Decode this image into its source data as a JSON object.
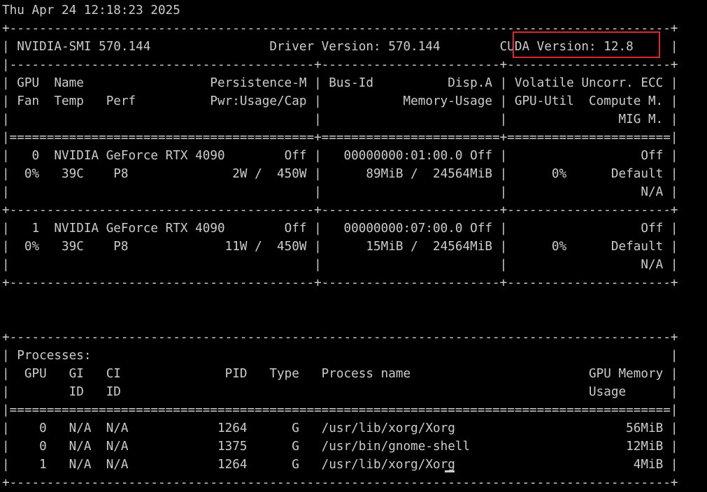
{
  "terminal": {
    "lines": [
      "Thu Apr 24 12:18:23 2025",
      "+-----------------------------------------------------------------------------------------+",
      "| NVIDIA-SMI 570.144                Driver Version: 570.144        CUDA Version: 12.8     |",
      "|-----------------------------------------+------------------------+----------------------+",
      "| GPU  Name                 Persistence-M | Bus-Id          Disp.A | Volatile Uncorr. ECC |",
      "| Fan  Temp   Perf          Pwr:Usage/Cap |           Memory-Usage | GPU-Util  Compute M. |",
      "|                                         |                        |               MIG M. |",
      "|=========================================+========================+======================|",
      "|   0  NVIDIA GeForce RTX 4090        Off |   00000000:01:00.0 Off |                  Off |",
      "|  0%   39C    P8              2W /  450W |      89MiB /  24564MiB |      0%      Default |",
      "|                                         |                        |                  N/A |",
      "+-----------------------------------------+------------------------+----------------------+",
      "|   1  NVIDIA GeForce RTX 4090        Off |   00000000:07:00.0 Off |                  Off |",
      "|  0%   39C    P8             11W /  450W |      15MiB /  24564MiB |      0%      Default |",
      "|                                         |                        |                  N/A |",
      "+-----------------------------------------+------------------------+----------------------+",
      "",
      "",
      "+-----------------------------------------------------------------------------------------+",
      "| Processes:                                                                              |",
      "|  GPU   GI   CI              PID   Type   Process name                        GPU Memory |",
      "|        ID   ID                                                               Usage      |",
      "|=========================================================================================|",
      "|    0   N/A  N/A            1264      G   /usr/lib/xorg/Xorg                       56MiB |",
      "|    0   N/A  N/A            1375      G   /usr/bin/gnome-shell                     12MiB |",
      "|    1   N/A  N/A            1264      G   /usr/lib/xorg/Xorg                        4MiB |",
      "+-----------------------------------------------------------------------------------------+"
    ]
  },
  "colors": {
    "background": "#000000",
    "foreground": "#cccccc",
    "highlight_border": "#e0242a"
  }
}
